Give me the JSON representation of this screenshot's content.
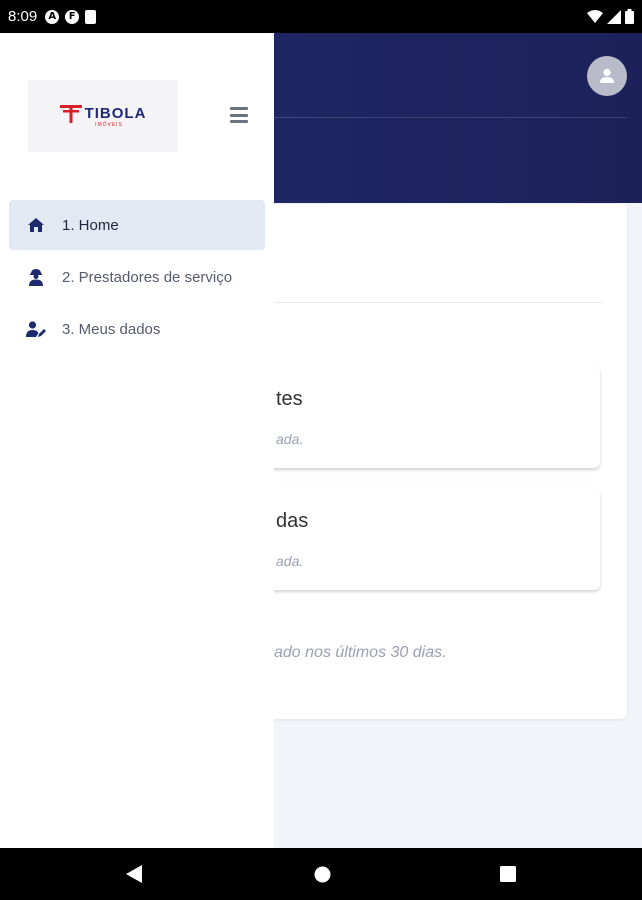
{
  "status_bar": {
    "time": "8:09",
    "left_icons": [
      "A",
      "F"
    ]
  },
  "drawer": {
    "logo": {
      "name": "TIBOLA",
      "sub": "IMÓVEIS"
    },
    "items": [
      {
        "label": "1. Home",
        "icon": "home-icon",
        "active": true
      },
      {
        "label": "2. Prestadores de serviço",
        "icon": "worker-icon",
        "active": false
      },
      {
        "label": "3. Meus dados",
        "icon": "user-edit-icon",
        "active": false
      }
    ]
  },
  "background": {
    "card1": {
      "title": "tes",
      "text": "ada."
    },
    "card2": {
      "title": "das",
      "text": "ada."
    },
    "footer_text": "ado nos últimos 30 dias."
  },
  "colors": {
    "header": "#1f2a6b",
    "active_item": "#e3e9f2",
    "icon": "#1e2a6e",
    "logo_red": "#d61f26"
  }
}
